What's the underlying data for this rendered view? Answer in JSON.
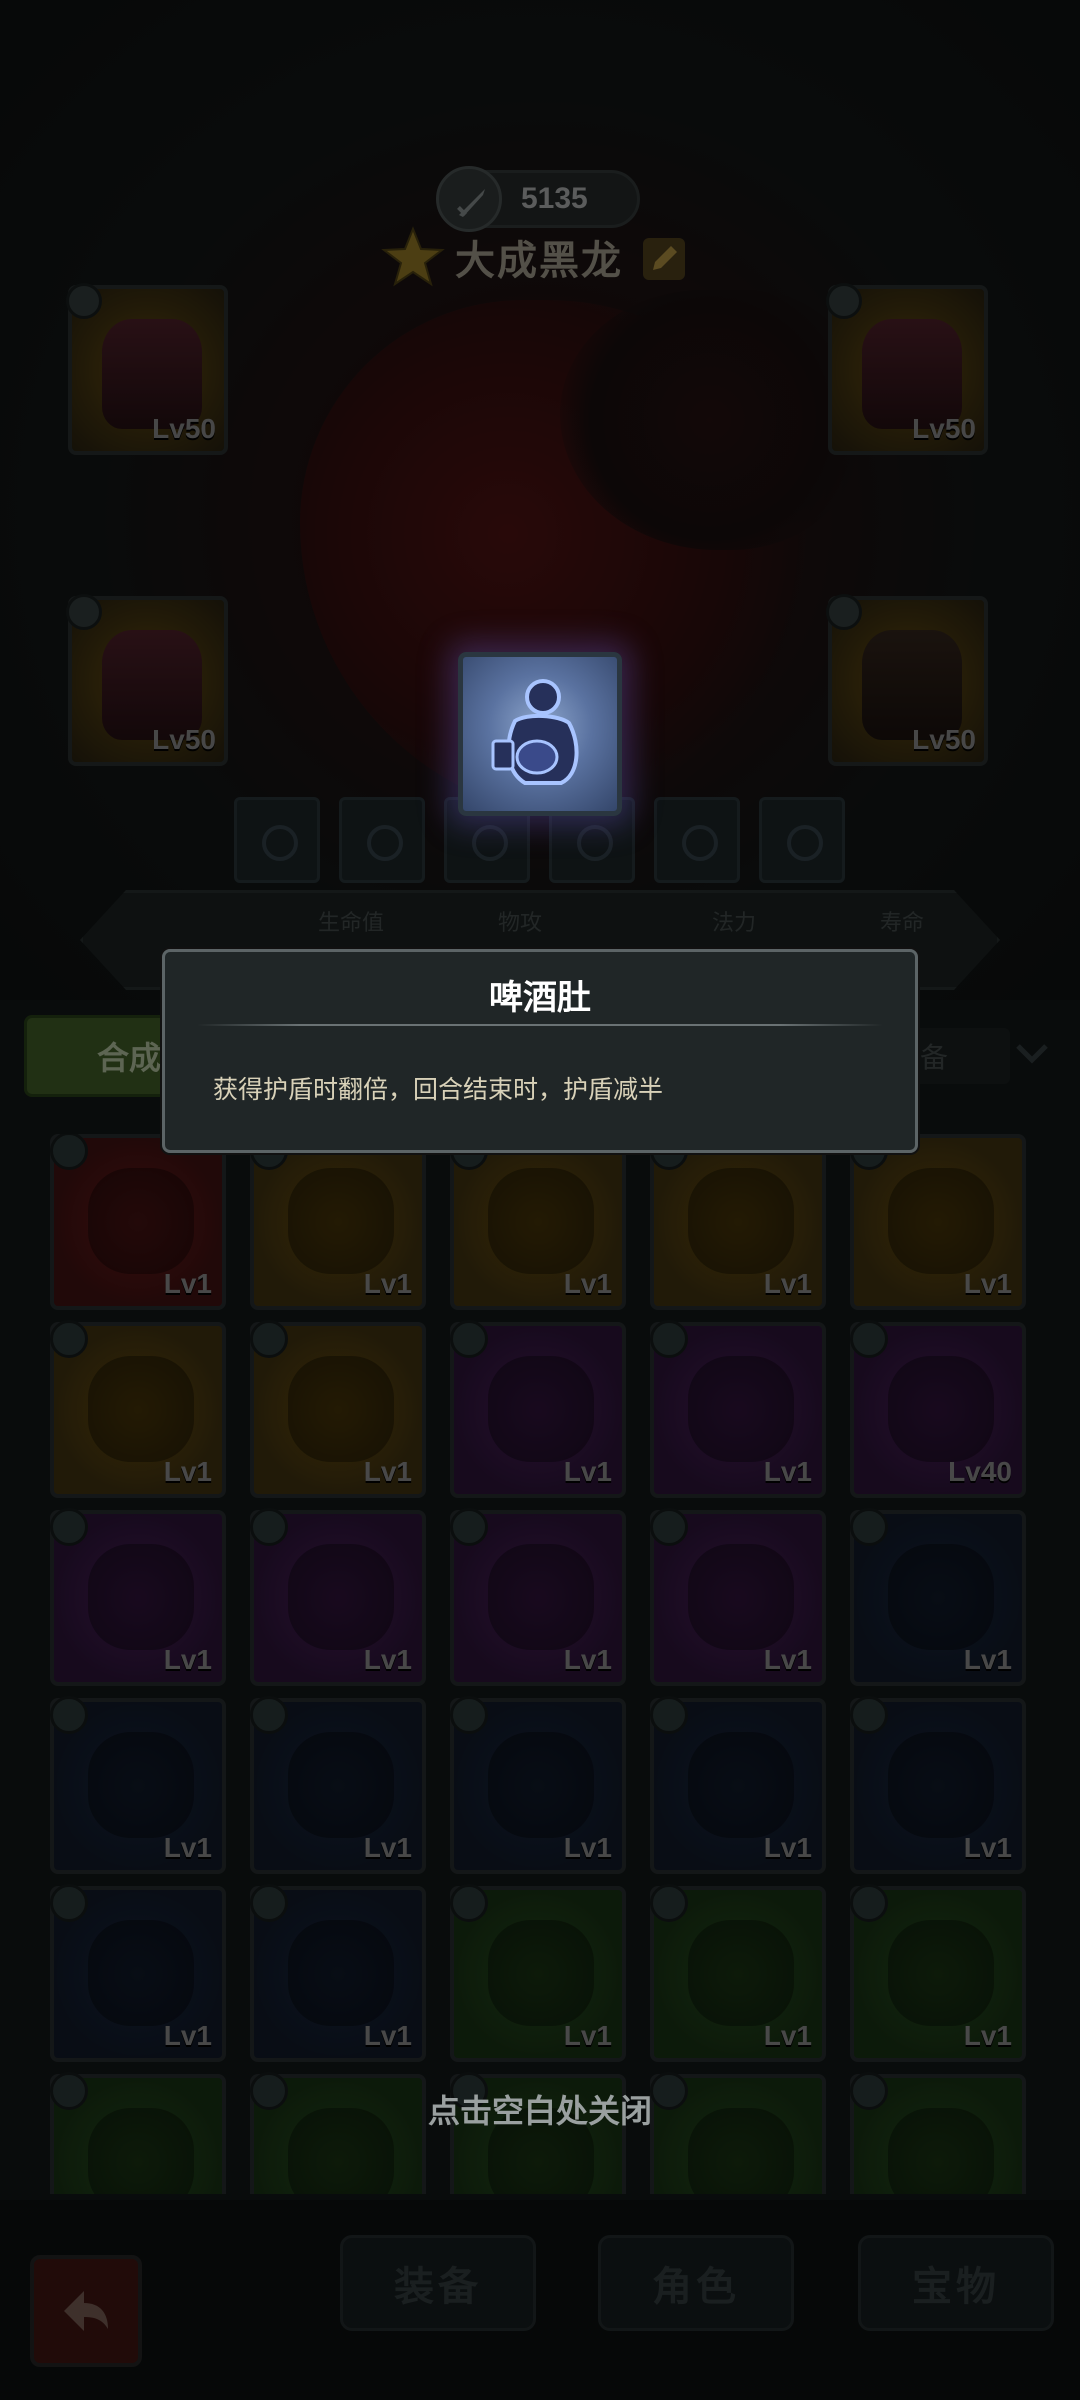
{
  "hero": {
    "power_value": "5135",
    "name": "大成黑龙",
    "equipment_slots": [
      {
        "level": "Lv50"
      },
      {
        "level": "Lv50"
      },
      {
        "level": "Lv50"
      },
      {
        "level": "Lv50"
      }
    ],
    "stats": {
      "labels": [
        "生命值",
        "物攻",
        "法力",
        "寿命"
      ]
    }
  },
  "merge_button": {
    "label": "合成"
  },
  "filter": {
    "label": "备"
  },
  "inventory": {
    "items": [
      {
        "level": "Lv1",
        "quality": "red"
      },
      {
        "level": "Lv1",
        "quality": "gold"
      },
      {
        "level": "Lv1",
        "quality": "gold"
      },
      {
        "level": "Lv1",
        "quality": "gold"
      },
      {
        "level": "Lv1",
        "quality": "gold"
      },
      {
        "level": "Lv1",
        "quality": "gold"
      },
      {
        "level": "Lv1",
        "quality": "gold"
      },
      {
        "level": "Lv1",
        "quality": "purple"
      },
      {
        "level": "Lv1",
        "quality": "purple"
      },
      {
        "level": "Lv40",
        "quality": "purple"
      },
      {
        "level": "Lv1",
        "quality": "purple"
      },
      {
        "level": "Lv1",
        "quality": "purple"
      },
      {
        "level": "Lv1",
        "quality": "purple"
      },
      {
        "level": "Lv1",
        "quality": "purple"
      },
      {
        "level": "Lv1",
        "quality": "blue"
      },
      {
        "level": "Lv1",
        "quality": "blue"
      },
      {
        "level": "Lv1",
        "quality": "blue"
      },
      {
        "level": "Lv1",
        "quality": "blue"
      },
      {
        "level": "Lv1",
        "quality": "blue"
      },
      {
        "level": "Lv1",
        "quality": "blue"
      },
      {
        "level": "Lv1",
        "quality": "blue"
      },
      {
        "level": "Lv1",
        "quality": "blue"
      },
      {
        "level": "Lv1",
        "quality": "green"
      },
      {
        "level": "Lv1",
        "quality": "green"
      },
      {
        "level": "Lv1",
        "quality": "green"
      },
      {
        "level": "",
        "quality": "green"
      },
      {
        "level": "",
        "quality": "green"
      },
      {
        "level": "",
        "quality": "green"
      },
      {
        "level": "",
        "quality": "green"
      },
      {
        "level": "",
        "quality": "green"
      }
    ]
  },
  "popup": {
    "title": "啤酒肚",
    "description": "获得护盾时翻倍，回合结束时，护盾减半",
    "skill_icon": "beer-belly-icon"
  },
  "close_hint": "点击空白处关闭",
  "bottom_nav": {
    "tabs": [
      {
        "label": "装备"
      },
      {
        "label": "角色"
      },
      {
        "label": "宝物"
      }
    ]
  },
  "colors": {
    "popup_bg": "#202627",
    "popup_border": "#5c6466",
    "title_text": "#ffffff",
    "desc_text": "#d8d1b8",
    "merge_green": "#4a6a2e"
  }
}
